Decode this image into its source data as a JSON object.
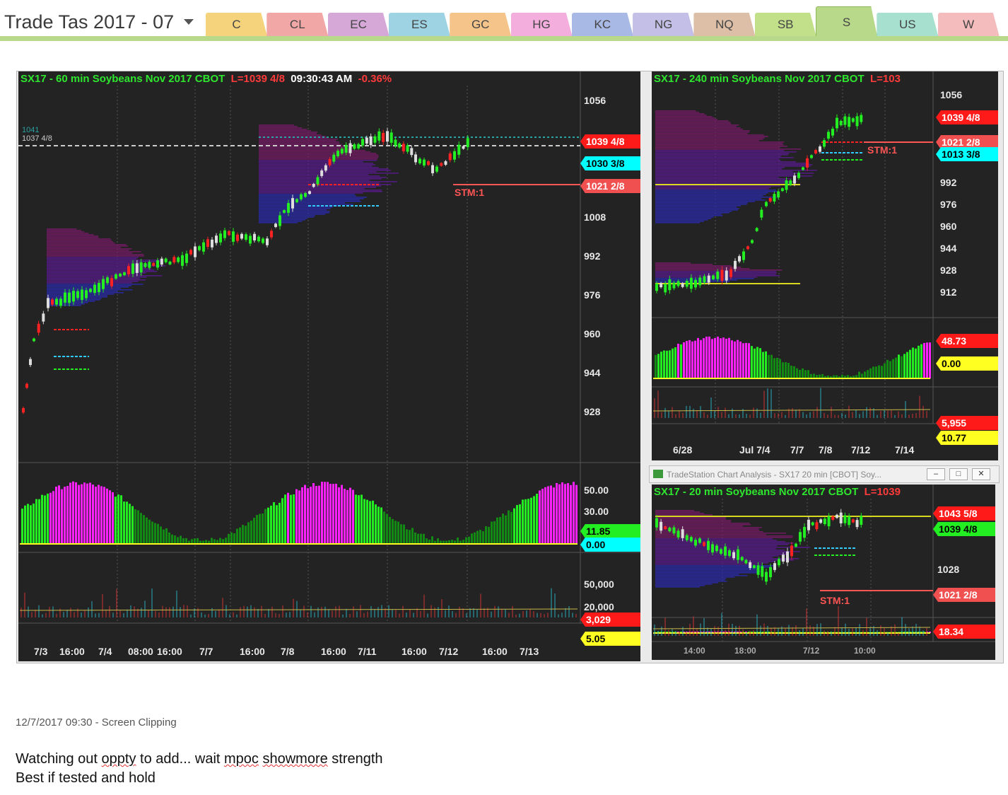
{
  "notebook": {
    "title": "Trade Tas 2017 - 07"
  },
  "tabs": [
    {
      "label": "C",
      "color": "#f5d37c"
    },
    {
      "label": "CL",
      "color": "#f2a7a7"
    },
    {
      "label": "EC",
      "color": "#d5a8d8"
    },
    {
      "label": "ES",
      "color": "#9ed3e3"
    },
    {
      "label": "GC",
      "color": "#f5c48a"
    },
    {
      "label": "HG",
      "color": "#f3aede"
    },
    {
      "label": "KC",
      "color": "#a9b9e6"
    },
    {
      "label": "NG",
      "color": "#c3bfe6"
    },
    {
      "label": "NQ",
      "color": "#dcbfa6"
    },
    {
      "label": "SB",
      "color": "#c2df8a"
    },
    {
      "label": "S",
      "color": "#b8d88a",
      "active": true
    },
    {
      "label": "US",
      "color": "#a8e0d0"
    },
    {
      "label": "W",
      "color": "#f4bcbc"
    }
  ],
  "chart60": {
    "title_symbol": "SX17 - 60 min  Soybeans Nov 2017  CBOT",
    "title_last": "L=1039 4/8",
    "title_time": "09:30:43 AM",
    "title_change": "-0.36%",
    "price_axis": [
      "1056",
      "1008",
      "992",
      "976",
      "960",
      "944",
      "928"
    ],
    "small_labels": [
      "1041",
      "1037 4/8"
    ],
    "tags": [
      {
        "text": "1039 4/8",
        "bg": "#ff1a1a",
        "fg": "#ffffff"
      },
      {
        "text": "1030 3/8",
        "bg": "#00ffff",
        "fg": "#000000"
      },
      {
        "text": "1021 2/8",
        "bg": "#f05050",
        "fg": "#ffffff"
      }
    ],
    "stm": "STM:1",
    "osc_axis": [
      "50.00",
      "30.00"
    ],
    "osc_tags": [
      {
        "text": "11.85",
        "bg": "#22ee22",
        "fg": "#000000"
      },
      {
        "text": "0.00",
        "bg": "#00ffff",
        "fg": "#000000"
      }
    ],
    "vol_axis": [
      "50,000",
      "20,000"
    ],
    "vol_tags": [
      {
        "text": "3,029",
        "bg": "#ff1a1a",
        "fg": "#ffffff"
      },
      {
        "text": "5.05",
        "bg": "#ffff22",
        "fg": "#000000"
      }
    ],
    "dates": [
      "7/3",
      "16:00",
      "7/4",
      "08:00",
      "16:00",
      "7/7",
      "16:00",
      "7/8",
      "16:00",
      "7/11",
      "16:00",
      "7/12",
      "16:00",
      "7/13"
    ]
  },
  "chart240": {
    "title_symbol": "SX17 - 240 min  Soybeans Nov 2017  CBOT",
    "title_last": "L=103",
    "price_axis": [
      "1056",
      "992",
      "976",
      "960",
      "944",
      "928",
      "912"
    ],
    "tags": [
      {
        "text": "1039 4/8",
        "bg": "#ff1a1a",
        "fg": "#ffffff"
      },
      {
        "text": "1021 2/8",
        "bg": "#f05050",
        "fg": "#ffffff"
      },
      {
        "text": "1013 3/8",
        "bg": "#00ffff",
        "fg": "#000000"
      }
    ],
    "stm": "STM:1",
    "osc_tags": [
      {
        "text": "48.73",
        "bg": "#ff1a1a",
        "fg": "#ffffff"
      },
      {
        "text": "0.00",
        "bg": "#ffff22",
        "fg": "#000000"
      }
    ],
    "vol_tags": [
      {
        "text": "5,955",
        "bg": "#ff1a1a",
        "fg": "#ffffff"
      },
      {
        "text": "10.77",
        "bg": "#ffff22",
        "fg": "#000000"
      }
    ],
    "dates": [
      "6/28",
      "Jul  7/4",
      "7/7",
      "7/8",
      "7/12",
      "7/14"
    ]
  },
  "window20": {
    "window_title": "TradeStation Chart Analysis - SX17 20 min [CBOT] Soy...",
    "title_symbol": "SX17 - 20 min  Soybeans Nov 2017  CBOT",
    "title_last": "L=1039",
    "price_axis": [
      "1028"
    ],
    "tags": [
      {
        "text": "1043 5/8",
        "bg": "#ff1a1a",
        "fg": "#ffffff"
      },
      {
        "text": "1039 4/8",
        "bg": "#22ee22",
        "fg": "#000000"
      },
      {
        "text": "1021 2/8",
        "bg": "#f05050",
        "fg": "#ffffff"
      }
    ],
    "stm": "STM:1",
    "osc_tags": [
      {
        "text": "18.34",
        "bg": "#ff1a1a",
        "fg": "#ffffff"
      }
    ],
    "dates": [
      "14:00",
      "18:00",
      "7/12",
      "10:00"
    ]
  },
  "clip_meta": "12/7/2017 09:30 - Screen Clipping",
  "notes": {
    "line1_a": "Watching out ",
    "line1_b": "oppty",
    "line1_c": " to add... wait ",
    "line1_d": "mpoc",
    "line1_e": " ",
    "line1_f": "showmore",
    "line1_g": " strength",
    "line2": "Best if tested and hold"
  }
}
